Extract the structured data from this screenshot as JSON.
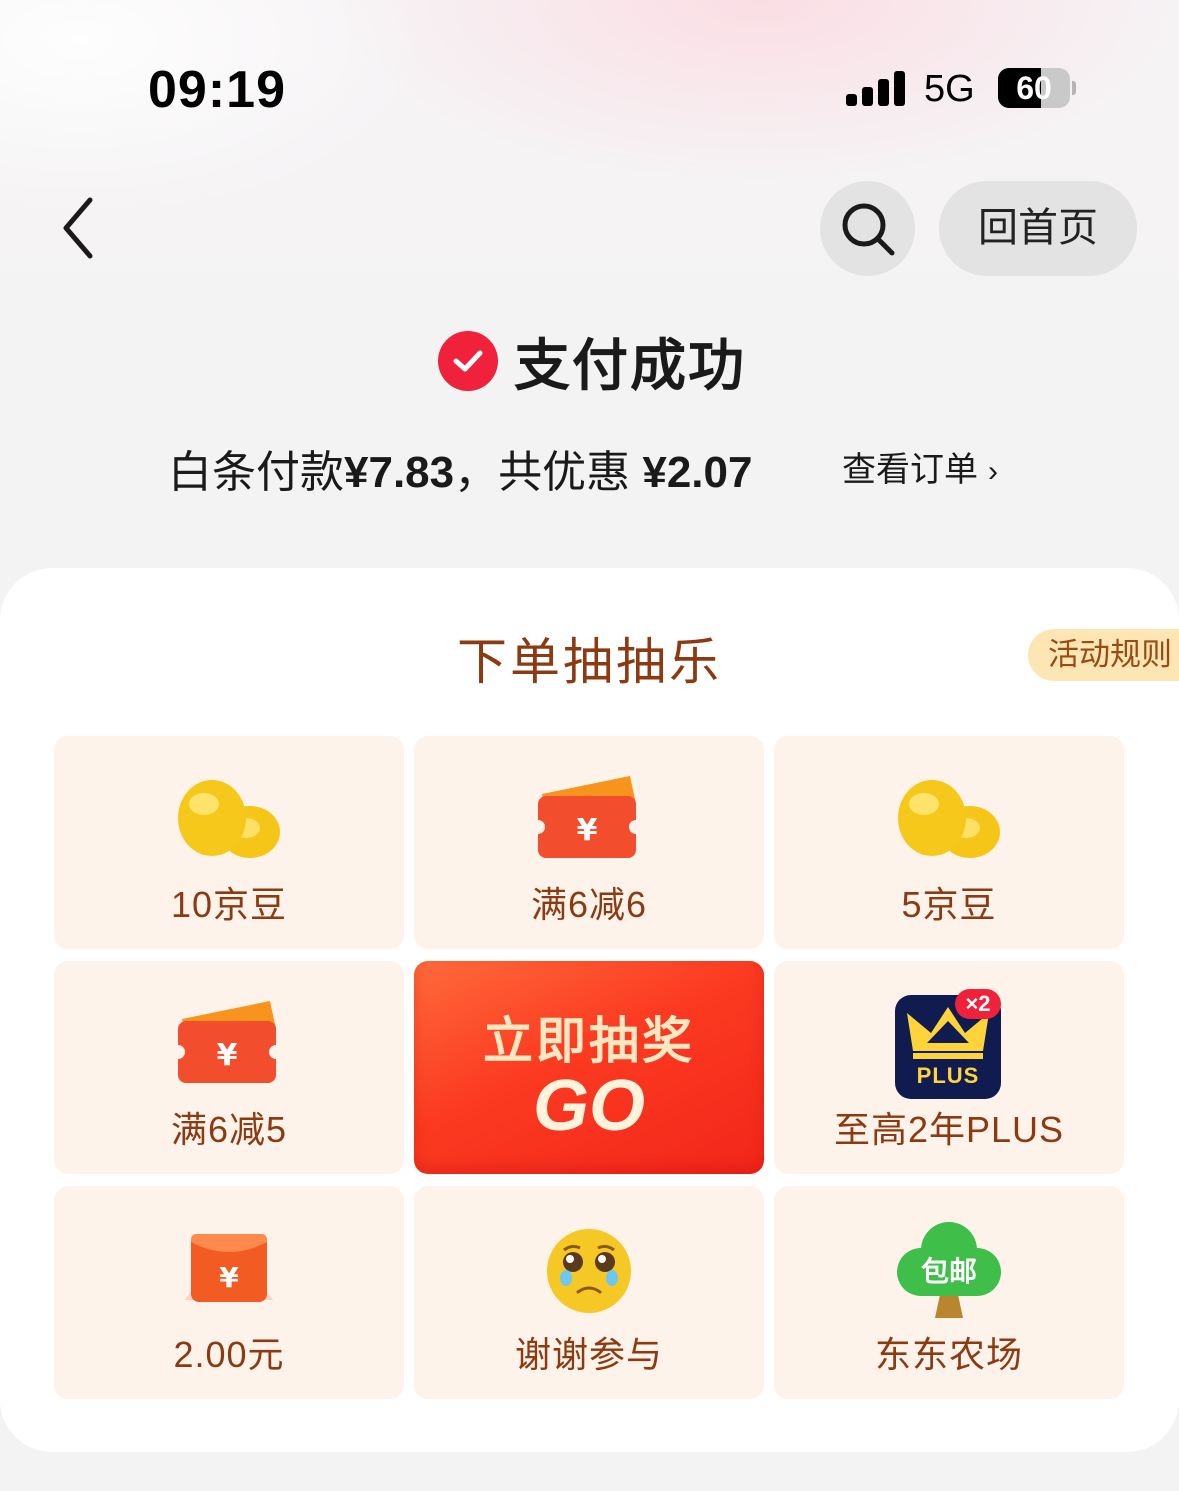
{
  "status_bar": {
    "time": "09:19",
    "network": "5G",
    "battery": "60",
    "battery_level_percent": 60,
    "signal_bars": 4
  },
  "nav": {
    "home_label": "回首页"
  },
  "payment": {
    "title": "支付成功",
    "summary_prefix": "白条付款",
    "paid_amount": "¥7.83",
    "summary_sep": "，共优惠",
    "discount_amount": "¥2.07",
    "view_order": "查看订单",
    "status_color": "#f0213a"
  },
  "lottery": {
    "title": "下单抽抽乐",
    "rules_label": "活动规则",
    "draw_title": "立即抽奖",
    "draw_go": "GO",
    "prizes": [
      {
        "label": "10京豆",
        "icon": "jingdou-beans-icon"
      },
      {
        "label": "满6减6",
        "icon": "coupon-ticket-icon"
      },
      {
        "label": "5京豆",
        "icon": "jingdou-beans-icon"
      },
      {
        "label": "满6减5",
        "icon": "coupon-ticket-icon"
      },
      {
        "label": "至高2年PLUS",
        "icon": "plus-membership-crown-icon",
        "badge": "×2",
        "icon_text": "PLUS"
      },
      {
        "label": "2.00元",
        "icon": "red-envelope-icon"
      },
      {
        "label": "谢谢参与",
        "icon": "teary-face-emoji-icon"
      },
      {
        "label": "东东农场",
        "icon": "farm-tree-icon",
        "icon_text": "包邮"
      }
    ],
    "accent_color": "#8c3a12"
  }
}
